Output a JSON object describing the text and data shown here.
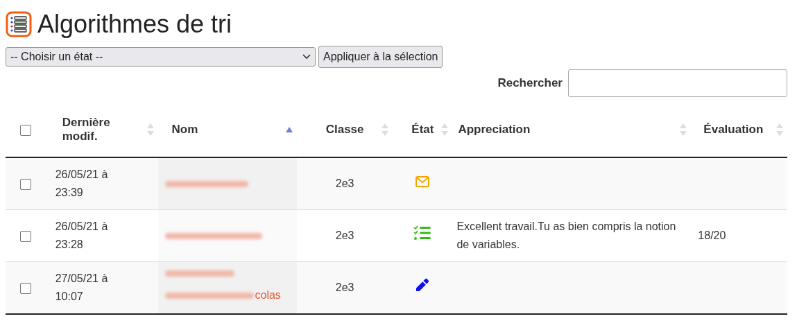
{
  "title": "Algorithmes de tri",
  "bulk_action": {
    "select_value": "-- Choisir un état --",
    "button": "Appliquer à la sélection"
  },
  "search": {
    "label": "Rechercher"
  },
  "table": {
    "select_all_checked": false,
    "columns": [
      {
        "label": "Dernière modif.",
        "sorted": false
      },
      {
        "label": "Nom",
        "sorted": true
      },
      {
        "label": "Classe",
        "sorted": false
      },
      {
        "label": "État",
        "sorted": false
      },
      {
        "label": "Appreciation",
        "sorted": false
      },
      {
        "label": "Évaluation",
        "sorted": false
      }
    ],
    "rows": [
      {
        "checked": false,
        "date": "26/05/21 à 23:39",
        "name_redacted": true,
        "classe": "2e3",
        "state": {
          "kind": "envelope"
        }
      },
      {
        "checked": false,
        "date": "26/05/21 à 23:28",
        "name_redacted": true,
        "classe": "2e3",
        "state": {
          "kind": "checklist"
        },
        "appreciation": "Excellent travail.Tu as bien compris la notion de variables.",
        "evaluation": "18/20"
      },
      {
        "checked": false,
        "date": "27/05/21 à 10:07",
        "name_redacted": true,
        "name_visible_part": "colas",
        "classe": "2e3",
        "state": {
          "kind": "pencil"
        }
      }
    ]
  }
}
